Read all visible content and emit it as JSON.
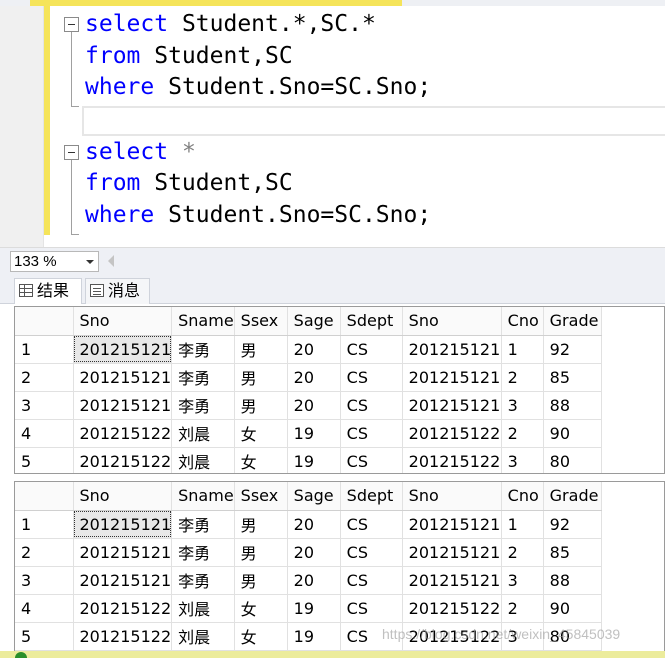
{
  "editor": {
    "query1": {
      "kw_select": "select",
      "select_rest": " Student.*,SC.*",
      "kw_from": "from",
      "from_rest": " Student,SC",
      "kw_where": "where",
      "where_rest": " Student.Sno=SC.Sno;"
    },
    "query2": {
      "kw_select": "select",
      "select_rest": " *",
      "kw_from": "from",
      "from_rest": " Student,SC",
      "kw_where": "where",
      "where_rest": " Student.Sno=SC.Sno;"
    }
  },
  "zoom": {
    "value": "133 %"
  },
  "tabs": {
    "results_label": "结果",
    "messages_label": "消息"
  },
  "columns": [
    "Sno",
    "Sname",
    "Ssex",
    "Sage",
    "Sdept",
    "Sno",
    "Cno",
    "Grade"
  ],
  "result_grids": [
    {
      "rows": [
        {
          "num": "1",
          "cells": [
            "201215121",
            "李勇",
            "男",
            "20",
            "CS",
            "201215121",
            "1",
            "92"
          ]
        },
        {
          "num": "2",
          "cells": [
            "201215121",
            "李勇",
            "男",
            "20",
            "CS",
            "201215121",
            "2",
            "85"
          ]
        },
        {
          "num": "3",
          "cells": [
            "201215121",
            "李勇",
            "男",
            "20",
            "CS",
            "201215121",
            "3",
            "88"
          ]
        },
        {
          "num": "4",
          "cells": [
            "201215122",
            "刘晨",
            "女",
            "19",
            "CS",
            "201215122",
            "2",
            "90"
          ]
        },
        {
          "num": "5",
          "cells": [
            "201215122",
            "刘晨",
            "女",
            "19",
            "CS",
            "201215122",
            "3",
            "80"
          ]
        }
      ]
    },
    {
      "rows": [
        {
          "num": "1",
          "cells": [
            "201215121",
            "李勇",
            "男",
            "20",
            "CS",
            "201215121",
            "1",
            "92"
          ]
        },
        {
          "num": "2",
          "cells": [
            "201215121",
            "李勇",
            "男",
            "20",
            "CS",
            "201215121",
            "2",
            "85"
          ]
        },
        {
          "num": "3",
          "cells": [
            "201215121",
            "李勇",
            "男",
            "20",
            "CS",
            "201215121",
            "3",
            "88"
          ]
        },
        {
          "num": "4",
          "cells": [
            "201215122",
            "刘晨",
            "女",
            "19",
            "CS",
            "201215122",
            "2",
            "90"
          ]
        },
        {
          "num": "5",
          "cells": [
            "201215122",
            "刘晨",
            "女",
            "19",
            "CS",
            "201215122",
            "3",
            "80"
          ]
        }
      ]
    }
  ],
  "watermark": "https://blog.csdn.net/weixin_45845039",
  "colors": {
    "keyword": "#0000ff",
    "operator": "#808080",
    "change_bar": "#f5e45a",
    "status_ok": "#2a8f2a"
  }
}
